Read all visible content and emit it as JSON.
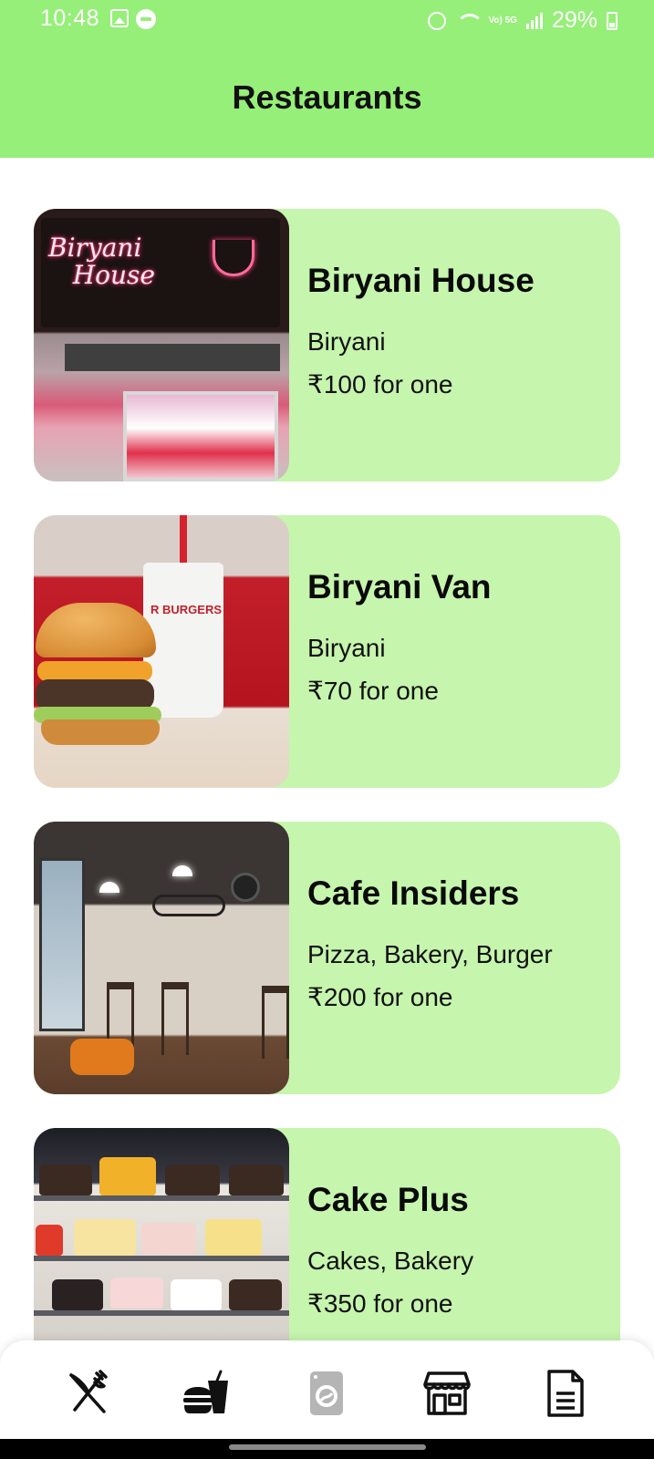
{
  "status_bar": {
    "time": "10:48",
    "battery": "29%",
    "network": "Vo) 5G"
  },
  "header": {
    "title": "Restaurants",
    "background": "#96ef78"
  },
  "restaurants": [
    {
      "name": "Biryani House",
      "cuisine": "Biryani",
      "price": "₹100 for one"
    },
    {
      "name": "Biryani Van",
      "cuisine": "Biryani",
      "price": "₹70 for one"
    },
    {
      "name": "Cafe Insiders",
      "cuisine": "Pizza, Bakery, Burger",
      "price": "₹200 for one"
    },
    {
      "name": "Cake Plus",
      "cuisine": "Cakes, Bakery",
      "price": "₹350 for one"
    }
  ],
  "card_background": "#c6f5ae",
  "bottom_nav": {
    "items": [
      {
        "icon": "fork-knife-icon"
      },
      {
        "icon": "burger-drink-icon"
      },
      {
        "icon": "washing-machine-icon"
      },
      {
        "icon": "store-icon"
      },
      {
        "icon": "document-icon"
      }
    ]
  }
}
